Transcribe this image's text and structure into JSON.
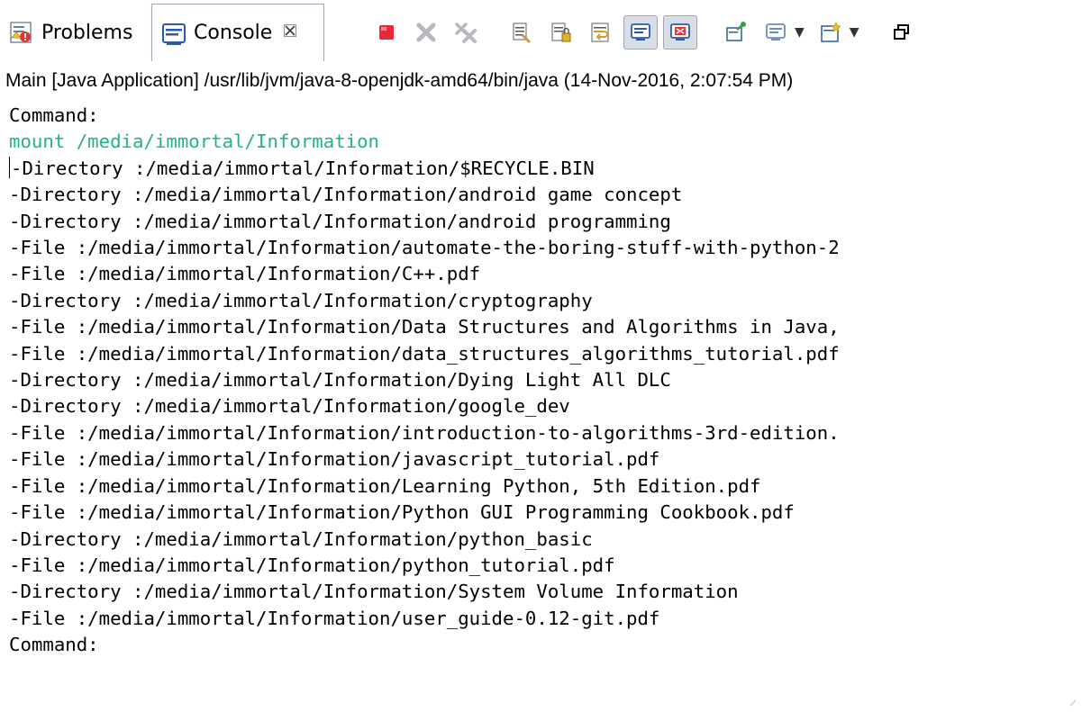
{
  "tabs": [
    {
      "label": "Problems",
      "icon": "problems-icon",
      "active": false
    },
    {
      "label": "Console",
      "icon": "console-icon",
      "active": true,
      "close_icon": "close-icon"
    }
  ],
  "toolbar": {
    "buttons": [
      {
        "name": "terminate-button",
        "icon": "stop-icon",
        "color": "#e8283c"
      },
      {
        "name": "remove-launch-button",
        "icon": "remove-x-icon"
      },
      {
        "name": "remove-all-terminated-button",
        "icon": "remove-all-icon"
      },
      {
        "name": "clear-console-button",
        "icon": "clear-console-icon"
      },
      {
        "name": "scroll-lock-button",
        "icon": "scroll-lock-icon"
      },
      {
        "name": "word-wrap-button",
        "icon": "word-wrap-icon"
      },
      {
        "name": "show-on-stdout-button",
        "icon": "show-stdout-icon",
        "pressed": true
      },
      {
        "name": "show-on-stderr-button",
        "icon": "show-stderr-icon",
        "pressed": true
      },
      {
        "name": "pin-console-button",
        "icon": "pin-icon"
      },
      {
        "name": "display-console-button",
        "icon": "display-console-icon",
        "dropdown": true
      },
      {
        "name": "open-console-button",
        "icon": "open-console-icon",
        "dropdown": true
      },
      {
        "name": "restore-button",
        "icon": "restore-icon"
      }
    ]
  },
  "status": "Main [Java Application] /usr/lib/jvm/java-8-openjdk-amd64/bin/java (14-Nov-2016, 2:07:54 PM)",
  "console": {
    "lines": [
      {
        "text": "Command:",
        "type": "output"
      },
      {
        "text": "mount /media/immortal/Information",
        "type": "input"
      },
      {
        "text": "-Directory :/media/immortal/Information/$RECYCLE.BIN",
        "type": "output",
        "caret": true
      },
      {
        "text": "-Directory :/media/immortal/Information/android game concept",
        "type": "output"
      },
      {
        "text": "-Directory :/media/immortal/Information/android programming",
        "type": "output"
      },
      {
        "text": "-File :/media/immortal/Information/automate-the-boring-stuff-with-python-2",
        "type": "output"
      },
      {
        "text": "-File :/media/immortal/Information/C++.pdf",
        "type": "output"
      },
      {
        "text": "-Directory :/media/immortal/Information/cryptography",
        "type": "output"
      },
      {
        "text": "-File :/media/immortal/Information/Data Structures and Algorithms in Java,",
        "type": "output"
      },
      {
        "text": "-File :/media/immortal/Information/data_structures_algorithms_tutorial.pdf",
        "type": "output"
      },
      {
        "text": "-Directory :/media/immortal/Information/Dying Light All DLC",
        "type": "output"
      },
      {
        "text": "-Directory :/media/immortal/Information/google_dev",
        "type": "output"
      },
      {
        "text": "-File :/media/immortal/Information/introduction-to-algorithms-3rd-edition.",
        "type": "output"
      },
      {
        "text": "-File :/media/immortal/Information/javascript_tutorial.pdf",
        "type": "output"
      },
      {
        "text": "-File :/media/immortal/Information/Learning Python, 5th Edition.pdf",
        "type": "output"
      },
      {
        "text": "-File :/media/immortal/Information/Python GUI Programming Cookbook.pdf",
        "type": "output"
      },
      {
        "text": "-Directory :/media/immortal/Information/python_basic",
        "type": "output"
      },
      {
        "text": "-File :/media/immortal/Information/python_tutorial.pdf",
        "type": "output"
      },
      {
        "text": "-Directory :/media/immortal/Information/System Volume Information",
        "type": "output"
      },
      {
        "text": "-File :/media/immortal/Information/user_guide-0.12-git.pdf",
        "type": "output"
      },
      {
        "text": "Command:",
        "type": "output"
      }
    ]
  },
  "colors": {
    "input_text": "#22b581",
    "output_text": "#000000",
    "tab_border": "#9aa6b6",
    "stop_red": "#e8283c"
  }
}
